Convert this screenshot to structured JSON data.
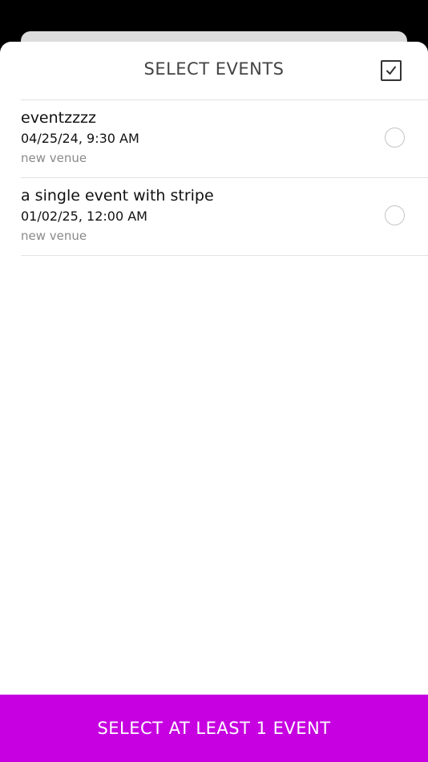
{
  "header": {
    "title": "SELECT EVENTS",
    "select_all_icon": "checkbox-checked-icon"
  },
  "events": [
    {
      "name": "eventzzzz",
      "datetime": "04/25/24, 9:30 AM",
      "venue": "new venue",
      "selected": false
    },
    {
      "name": "a single event with stripe",
      "datetime": "01/02/25, 12:00 AM",
      "venue": "new venue",
      "selected": false
    }
  ],
  "footer": {
    "button_label": "SELECT AT LEAST 1 EVENT"
  },
  "colors": {
    "accent": "#c600e0",
    "backdrop": "#000000",
    "sheet": "#ffffff",
    "muted_text": "#8a8a8a"
  }
}
